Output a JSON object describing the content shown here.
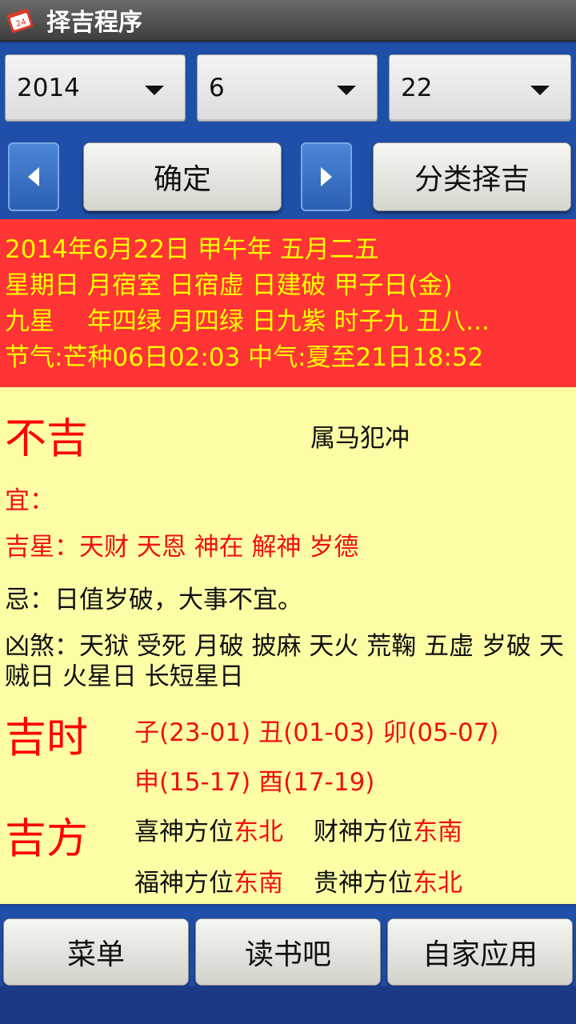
{
  "app": {
    "title": "择吉程序",
    "icon": "calendar-icon"
  },
  "date_picker": {
    "year": "2014",
    "month": "6",
    "day": "22"
  },
  "actions": {
    "prev_icon": "left-arrow-icon",
    "confirm_label": "确定",
    "next_icon": "right-arrow-icon",
    "category_label": "分类择吉"
  },
  "info": {
    "line1": "2014年6月22日 甲午年 五月二五",
    "line2": "星期日 月宿室 日宿虚 日建破 甲子日(金)",
    "line3": "九星　 年四绿 月四绿 日九紫 时子九 丑八...",
    "line4": "节气:芒种06日02:03 中气:夏至21日18:52"
  },
  "verdict": {
    "label": "不吉",
    "conflict": "属马犯冲"
  },
  "yi": {
    "label": "宜："
  },
  "ji_xing": {
    "text": "吉星：天财 天恩 神在 解神 岁德"
  },
  "ji": {
    "text": "忌：日值岁破，大事不宜。"
  },
  "xiong_sha": {
    "line1": "凶煞：天狱 受死 月破 披麻 天火 荒鞠 五虚 岁破 天",
    "line2": "贼日 火星日 长短星日"
  },
  "lucky_hours": {
    "label": "吉时",
    "line1": "子(23-01) 丑(01-03) 卯(05-07)",
    "line2": "申(15-17) 酉(17-19)"
  },
  "lucky_directions": {
    "label": "吉方",
    "xi_shen_label": "喜神方位",
    "xi_shen_value": "东北",
    "cai_shen_label": "财神方位",
    "cai_shen_value": "东南",
    "fu_shen_label": "福神方位",
    "fu_shen_value": "东南",
    "gui_shen_label": "贵神方位",
    "gui_shen_value": "东北"
  },
  "bottom_menu": {
    "menu_label": "菜单",
    "read_label": "读书吧",
    "apps_label": "自家应用"
  },
  "colors": {
    "blue_bg": "#1f4fa8",
    "red_band": "#ff3434",
    "band_text": "#ffff00",
    "content_bg": "#fdfda6",
    "accent_red": "#ff0000"
  }
}
